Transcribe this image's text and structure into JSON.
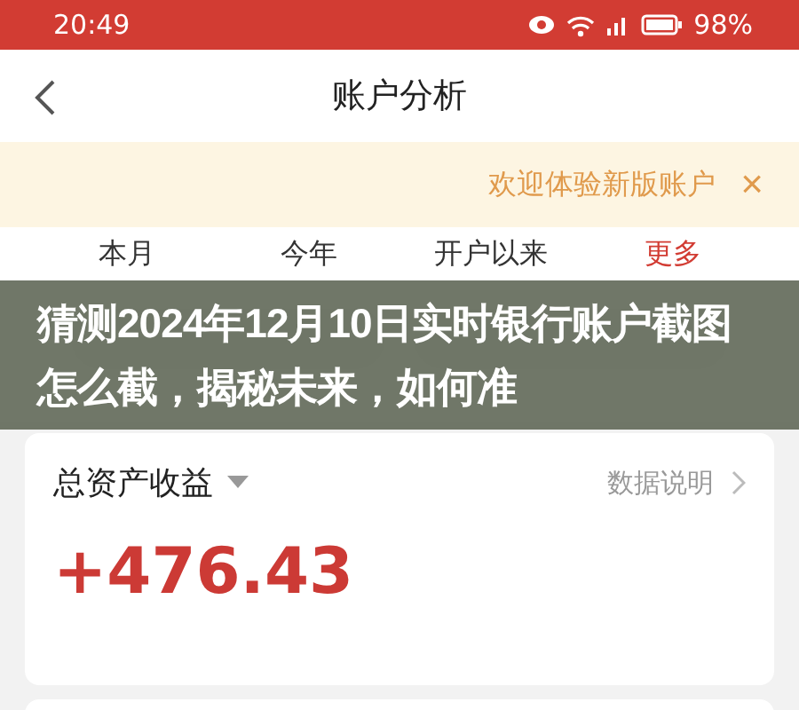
{
  "status_bar": {
    "time": "20:49",
    "battery": "98%"
  },
  "nav": {
    "title": "账户分析"
  },
  "notice": {
    "text": "欢迎体验新版账户",
    "close": "×"
  },
  "tabs": [
    {
      "label": "本月",
      "kind": "period"
    },
    {
      "label": "今年",
      "kind": "period"
    },
    {
      "label": "开户以来",
      "kind": "period"
    },
    {
      "label": "更多",
      "kind": "more"
    }
  ],
  "overlay": {
    "headline": "猜测2024年12月10日实时银行账户截图怎么截，揭秘未来，如何准"
  },
  "summary": {
    "title": "总资产收益",
    "link": "数据说明",
    "value": "+476.43"
  }
}
